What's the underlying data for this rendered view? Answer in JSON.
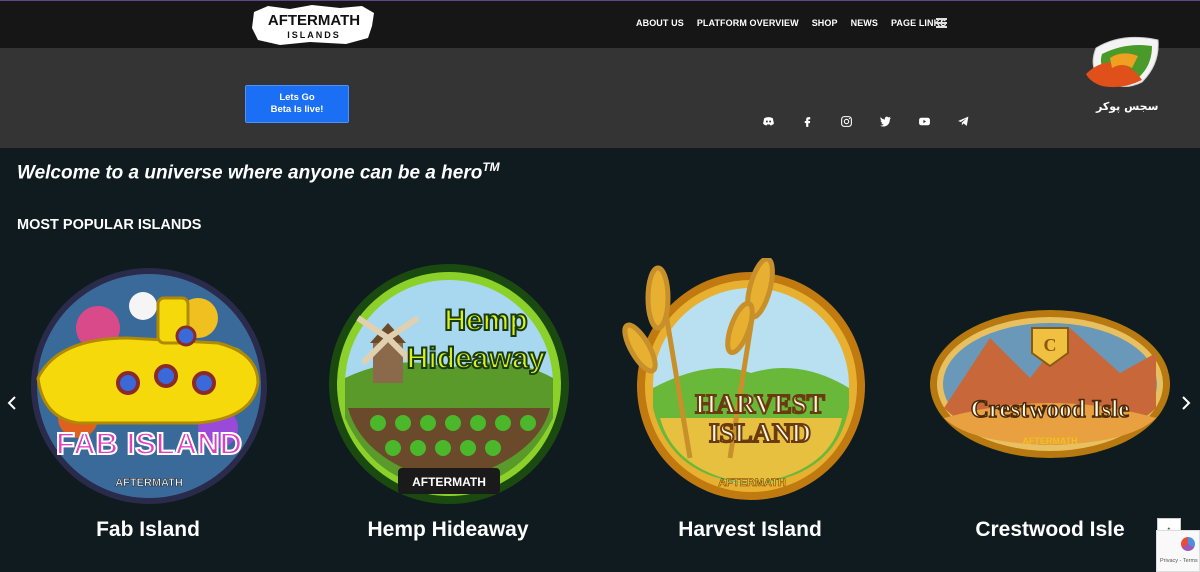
{
  "header": {
    "logo_top": "AFTERMATH",
    "logo_bottom": "ISLANDS",
    "nav": [
      "ABOUT US",
      "PLATFORM OVERVIEW",
      "SHOP",
      "NEWS",
      "PAGE LINKS"
    ]
  },
  "band": {
    "beta_line1": "Lets Go",
    "beta_line2": "Beta Is live!",
    "socials": [
      "discord-icon",
      "facebook-icon",
      "instagram-icon",
      "twitter-icon",
      "youtube-icon",
      "telegram-icon"
    ]
  },
  "partner": {
    "text": "سجس پوکر"
  },
  "hero": {
    "welcome": "Welcome to a universe where anyone can be a hero",
    "trademark": "TM",
    "section_title": "MOST POPULAR ISLANDS"
  },
  "islands": [
    {
      "name": "Fab Island",
      "badge_text": "FAB ISLAND",
      "color": "#f5d90a"
    },
    {
      "name": "Hemp Hideaway",
      "badge_text": "Hemp Hideaway",
      "color": "#8bd12a"
    },
    {
      "name": "Harvest Island",
      "badge_text": "HARVEST ISLAND",
      "color": "#e0a020"
    },
    {
      "name": "Crestwood Isle",
      "badge_text": "Crestwood Isle",
      "color": "#e08a20"
    }
  ],
  "footer": {
    "to_top": "↑",
    "recaptcha": "Privacy - Terms"
  },
  "colors": {
    "accent_blue": "#1a6ff5",
    "background": "#0f1b1f",
    "band": "#343434"
  }
}
